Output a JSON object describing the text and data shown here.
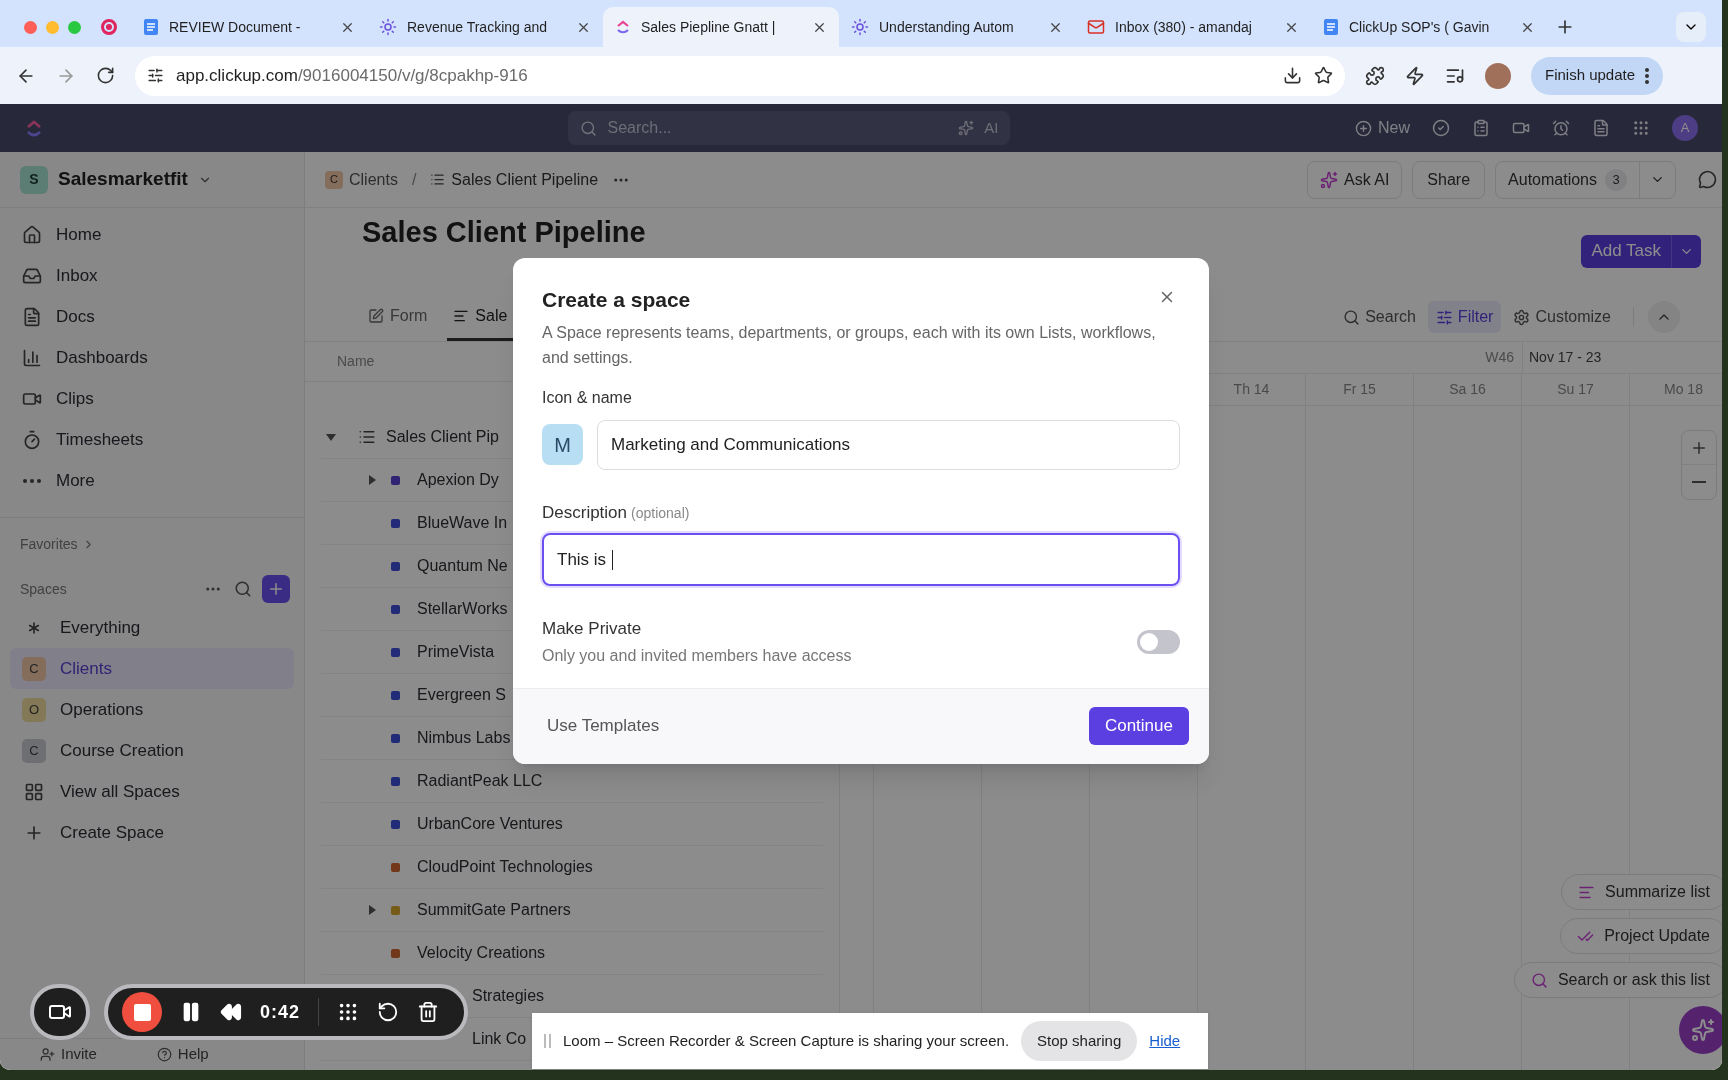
{
  "browser": {
    "tabs": [
      {
        "title": "REVIEW Document -",
        "selected": false
      },
      {
        "title": "Revenue Tracking and",
        "selected": false
      },
      {
        "title": "Sales Piepline Gnatt |",
        "selected": true
      },
      {
        "title": "Understanding Autom",
        "selected": false
      },
      {
        "title": "Inbox (380) - amandaj",
        "selected": false
      },
      {
        "title": "ClickUp SOP's ( Gavin",
        "selected": false
      }
    ],
    "url_host": "app.clickup.com",
    "url_path": "/9016004150/v/g/8cpakhp-916",
    "update_button": "Finish update"
  },
  "topbar": {
    "search_placeholder": "Search...",
    "ai_label": "AI",
    "new_button": "New",
    "avatar": "A"
  },
  "sidebar": {
    "workspace_initial": "S",
    "workspace": "Salesmarketfit",
    "nav": [
      "Home",
      "Inbox",
      "Docs",
      "Dashboards",
      "Clips",
      "Timesheets",
      "More"
    ],
    "favorites": "Favorites",
    "spaces_title": "Spaces",
    "spaces": [
      {
        "label": "Everything",
        "kind": "icon",
        "selected": false
      },
      {
        "label": "Clients",
        "kind": "avatar",
        "initial": "C",
        "color": "#856d5b",
        "selected": true
      },
      {
        "label": "Operations",
        "kind": "avatar",
        "initial": "O",
        "color": "#847956",
        "selected": false
      },
      {
        "label": "Course Creation",
        "kind": "avatar",
        "initial": "C",
        "color": "#6e6f72",
        "selected": false
      },
      {
        "label": "View all Spaces",
        "kind": "icon",
        "selected": false
      },
      {
        "label": "Create Space",
        "kind": "icon",
        "selected": false
      }
    ],
    "footer": [
      "Invite",
      "Help"
    ]
  },
  "breadcrumb": {
    "space_initial": "C",
    "space": "Clients",
    "separator": "/",
    "list": "Sales Client Pipeline"
  },
  "actions": {
    "ask_ai": "Ask AI",
    "share": "Share",
    "automations": "Automations",
    "automations_count": "3"
  },
  "title": "Sales Client Pipeline",
  "add_task": "Add Task",
  "view_tabs": [
    {
      "label": "Form",
      "selected": false
    },
    {
      "label": "Sale",
      "selected": true
    }
  ],
  "tools": [
    {
      "label": "Search",
      "selected": false
    },
    {
      "label": "Filter",
      "selected": true
    },
    {
      "label": "Customize",
      "selected": false
    }
  ],
  "list": {
    "column": "Name",
    "rows": [
      {
        "name": "Sales Client Pip",
        "kind": "list",
        "expanded": true
      },
      {
        "name": "Apexion Dy",
        "kind": "group",
        "expanded": false,
        "color": "#312374"
      },
      {
        "name": "BlueWave In",
        "kind": "task",
        "color": "#222b77"
      },
      {
        "name": "Quantum Ne",
        "kind": "task",
        "color": "#222b77"
      },
      {
        "name": "StellarWorks",
        "kind": "task",
        "color": "#222b77"
      },
      {
        "name": "PrimeVista",
        "kind": "task",
        "color": "#222b77"
      },
      {
        "name": "Evergreen S",
        "kind": "task",
        "color": "#222b77"
      },
      {
        "name": "Nimbus Labs",
        "kind": "task",
        "color": "#222b77"
      },
      {
        "name": "RadiantPeak LLC",
        "kind": "task",
        "color": "#222b77"
      },
      {
        "name": "UrbanCore Ventures",
        "kind": "task",
        "color": "#222b77"
      },
      {
        "name": "CloudPoint Technologies",
        "kind": "task",
        "color": "#72381a"
      },
      {
        "name": "SummitGate Partners",
        "kind": "group",
        "expanded": false,
        "color": "#765a17"
      },
      {
        "name": "Velocity Creations",
        "kind": "task",
        "color": "#72381a"
      },
      {
        "name": "Strategies",
        "kind": "covered"
      },
      {
        "name": "Link Co",
        "kind": "covered"
      }
    ]
  },
  "gantt": {
    "week": "W46",
    "range": "Nov 17 - 23",
    "days": [
      "Th 14",
      "Fr 15",
      "Sa 16",
      "Su 17",
      "Mo 18"
    ]
  },
  "ai_suggestions": [
    "Summarize list",
    "Project Update",
    "Search or ask this list"
  ],
  "modal": {
    "title": "Create a space",
    "description": "A Space represents teams, departments, or groups, each with its own Lists, workflows, and settings.",
    "name_label": "Icon & name",
    "icon_initial": "M",
    "name_value": "Marketing and Communications",
    "description_label": "Description",
    "description_hint": "(optional)",
    "description_value": "This is",
    "description_focused": true,
    "private_label": "Make Private",
    "private_hint": "Only you and invited members have access",
    "private_on": false,
    "templates": "Use Templates",
    "continue": "Continue"
  },
  "loom": {
    "timer": "0:42",
    "message": "Loom – Screen Recorder & Screen Capture is sharing your screen.",
    "stop": "Stop sharing",
    "hide": "Hide"
  }
}
